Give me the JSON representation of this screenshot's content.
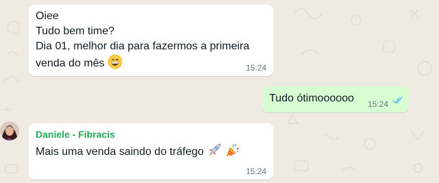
{
  "messages": {
    "first": {
      "lines": [
        "Oiee",
        "Tudo bem time?",
        "Dia 01, melhor dia para fazermos a primeira",
        "venda do mês"
      ],
      "emoji": "grinning-face-emoji",
      "time": "15:24"
    },
    "second": {
      "text": "Tudo ótimoooooo",
      "time": "15:24",
      "status": "read-double-check"
    },
    "third": {
      "sender": "Daniele - Fibracis",
      "text": "Mais uma venda saindo do tráfego",
      "emojis": [
        "rocket-emoji",
        "party-popper-emoji"
      ],
      "time": "15:24"
    }
  },
  "colors": {
    "incoming_bubble": "#ffffff",
    "outgoing_bubble": "#d9fdd3",
    "sender_name": "#1fa855",
    "read_ticks": "#53bdeb",
    "chat_background": "#efeae2"
  }
}
